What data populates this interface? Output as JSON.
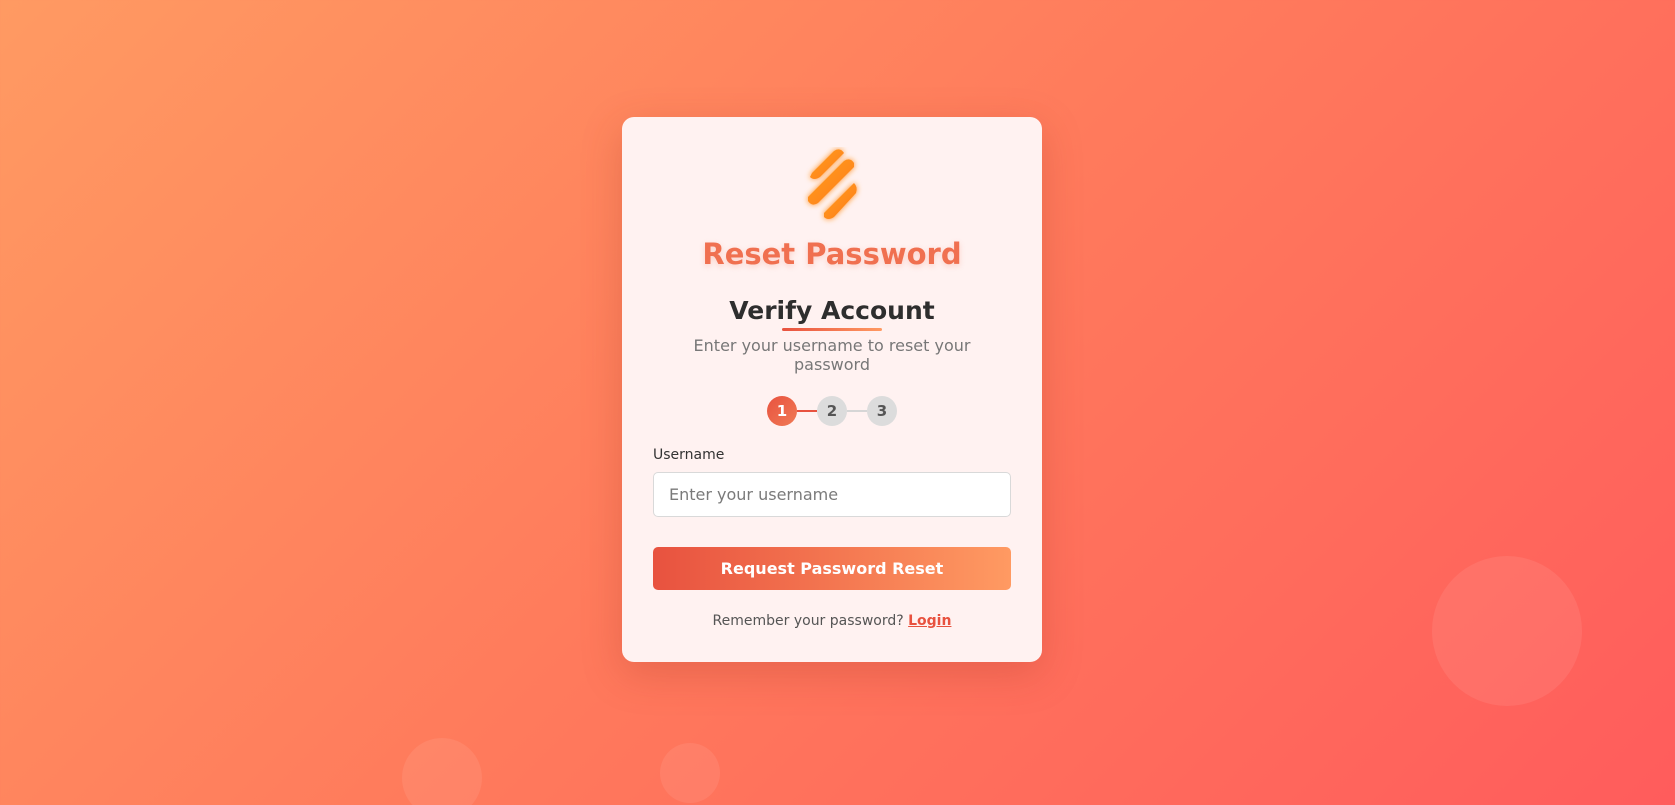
{
  "brand": {
    "title": "Reset Password",
    "logo_icon": "orange-stripes-logo-icon"
  },
  "step": {
    "title": "Verify Account",
    "description": "Enter your username to reset your password"
  },
  "stepper": {
    "steps": [
      "1",
      "2",
      "3"
    ],
    "active_index": 0
  },
  "form": {
    "username_label": "Username",
    "username_placeholder": "Enter your username",
    "username_value": "",
    "submit_label": "Request Password Reset"
  },
  "footer": {
    "prompt": "Remember your password?",
    "login_label": "Login"
  },
  "colors": {
    "accent": "#e8523f",
    "accent_light": "#ff9a62",
    "background_start": "#ff9a62",
    "background_end": "#ff5c5c"
  }
}
